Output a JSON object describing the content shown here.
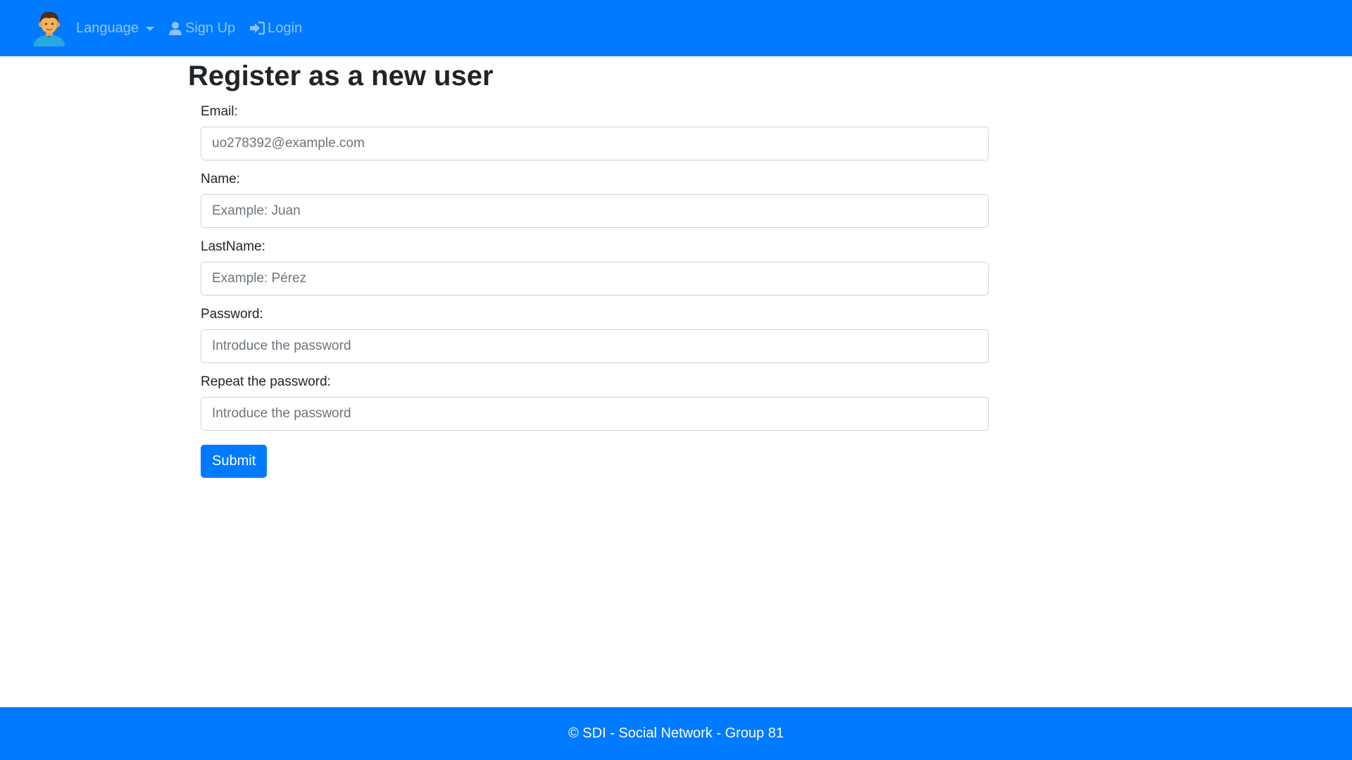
{
  "navbar": {
    "brand_icon": "user-avatar-logo",
    "language_label": "Language",
    "signup_label": "Sign Up",
    "login_label": "Login",
    "accent_color": "#007bff"
  },
  "page": {
    "title": "Register as a new user"
  },
  "form": {
    "email_label": "Email:",
    "email_placeholder": "uo278392@example.com",
    "name_label": "Name:",
    "name_placeholder": "Example: Juan",
    "lastname_label": "LastName:",
    "lastname_placeholder": "Example: Pérez",
    "password_label": "Password:",
    "password_placeholder": "Introduce the password",
    "repeat_password_label": "Repeat the password:",
    "repeat_password_placeholder": "Introduce the password",
    "submit_label": "Submit"
  },
  "footer": {
    "text": "© SDI - Social Network - Group 81"
  }
}
